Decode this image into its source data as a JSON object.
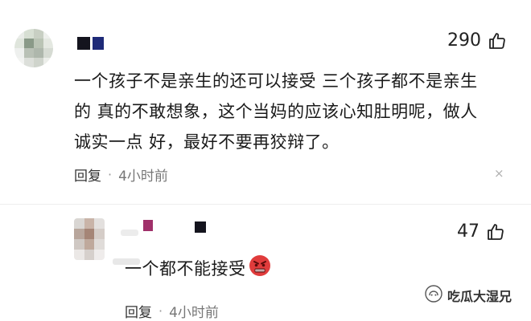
{
  "comments": [
    {
      "likes": "290",
      "lines": [
        "一个孩子不是亲生的还可以接受 三个孩子都不是亲生",
        "的 真的不敢想象，这个当妈的应该心知肚明呢，做人",
        "诚实一点 好，最好不要再狡辩了。"
      ],
      "reply_label": "回复",
      "separator": "·",
      "time": "4小时前",
      "close_symbol": "×"
    },
    {
      "likes": "47",
      "text": "一个都不能接受",
      "reply_label": "回复",
      "separator": "·",
      "time": "4小时前"
    }
  ],
  "watermark": "吃瓜大湿兄",
  "icons": {
    "like": "thumb-up-icon",
    "close": "close-icon",
    "emoji": "angry-face-emoji-icon",
    "watermark": "wechat-official-account-icon"
  },
  "colors": {
    "text": "#1a1a1a",
    "meta": "#777777",
    "emoji": "#e03c3c",
    "username_dark": "#14141e",
    "username_navy": "#1e2a78",
    "username_magenta": "#a0306a"
  }
}
